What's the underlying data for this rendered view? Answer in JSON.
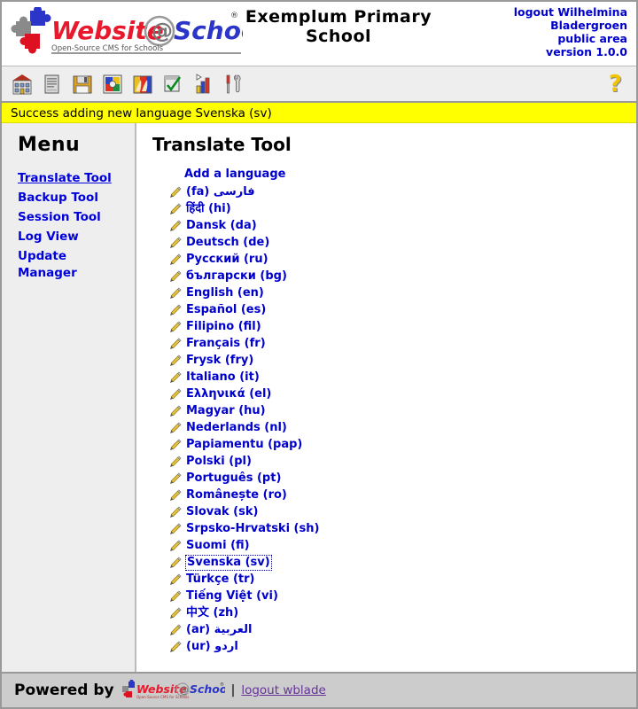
{
  "header": {
    "logo_text_1": "Website",
    "logo_at": "@",
    "logo_text_2": "School",
    "logo_registered": "®",
    "logo_tagline": "Open-Source CMS for Schools",
    "school_title": "Exemplum Primary School",
    "logout_line": "logout Wilhelmina Bladergroen",
    "area_line": "public area",
    "version_line": "version 1.0.0"
  },
  "toolbar": {
    "icons": [
      {
        "name": "school-icon",
        "title": "School"
      },
      {
        "name": "pages-icon",
        "title": "Pages"
      },
      {
        "name": "save-icon",
        "title": "Save"
      },
      {
        "name": "modules-icon",
        "title": "Modules"
      },
      {
        "name": "users-icon",
        "title": "Users"
      },
      {
        "name": "approve-icon",
        "title": "Approve"
      },
      {
        "name": "statistics-icon",
        "title": "Statistics"
      },
      {
        "name": "tools-icon",
        "title": "Tools"
      }
    ],
    "help_label": "?"
  },
  "message": {
    "text": "Success adding new language Svenska (sv)",
    "background": "#ffff00"
  },
  "sidebar": {
    "heading": "Menu",
    "items": [
      {
        "label": "Translate Tool",
        "active": true
      },
      {
        "label": "Backup Tool",
        "active": false
      },
      {
        "label": "Session Tool",
        "active": false
      },
      {
        "label": "Log View",
        "active": false
      },
      {
        "label": "Update Manager",
        "active": false
      }
    ]
  },
  "main": {
    "title": "Translate Tool",
    "add_language_label": "Add a language",
    "languages": [
      {
        "label": "فارسی (fa)",
        "rtl": true,
        "focused": false
      },
      {
        "label": "हिंदी (hi)",
        "rtl": false,
        "focused": false
      },
      {
        "label": "Dansk (da)",
        "rtl": false,
        "focused": false
      },
      {
        "label": "Deutsch (de)",
        "rtl": false,
        "focused": false
      },
      {
        "label": "Русский (ru)",
        "rtl": false,
        "focused": false
      },
      {
        "label": "български (bg)",
        "rtl": false,
        "focused": false
      },
      {
        "label": "English (en)",
        "rtl": false,
        "focused": false
      },
      {
        "label": "Español (es)",
        "rtl": false,
        "focused": false
      },
      {
        "label": "Filipino (fil)",
        "rtl": false,
        "focused": false
      },
      {
        "label": "Français (fr)",
        "rtl": false,
        "focused": false
      },
      {
        "label": "Frysk (fry)",
        "rtl": false,
        "focused": false
      },
      {
        "label": "Italiano (it)",
        "rtl": false,
        "focused": false
      },
      {
        "label": "Ελληνικά (el)",
        "rtl": false,
        "focused": false
      },
      {
        "label": "Magyar (hu)",
        "rtl": false,
        "focused": false
      },
      {
        "label": "Nederlands (nl)",
        "rtl": false,
        "focused": false
      },
      {
        "label": "Papiamentu (pap)",
        "rtl": false,
        "focused": false
      },
      {
        "label": "Polski (pl)",
        "rtl": false,
        "focused": false
      },
      {
        "label": "Português (pt)",
        "rtl": false,
        "focused": false
      },
      {
        "label": "Românеște (ro)",
        "rtl": false,
        "focused": false
      },
      {
        "label": "Slovak (sk)",
        "rtl": false,
        "focused": false
      },
      {
        "label": "Srpsko-Hrvatski (sh)",
        "rtl": false,
        "focused": false
      },
      {
        "label": "Suomi (fi)",
        "rtl": false,
        "focused": false
      },
      {
        "label": "Svenska (sv)",
        "rtl": false,
        "focused": true
      },
      {
        "label": "Türkçe (tr)",
        "rtl": false,
        "focused": false
      },
      {
        "label": "Tiếng Việt (vi)",
        "rtl": false,
        "focused": false
      },
      {
        "label": "中文 (zh)",
        "rtl": false,
        "focused": false
      },
      {
        "label": "العربية (ar)",
        "rtl": true,
        "focused": false
      },
      {
        "label": "اردو (ur)",
        "rtl": true,
        "focused": false
      }
    ]
  },
  "footer": {
    "powered_by": "Powered by",
    "separator": "|",
    "logout_label": "logout wblade"
  },
  "colors": {
    "link": "#0000cc",
    "menu_link": "#0000dd",
    "message_bg": "#ffff00",
    "sidebar_bg": "#eeeeee",
    "footer_bg": "#cccccc",
    "help": "#f2c500"
  }
}
